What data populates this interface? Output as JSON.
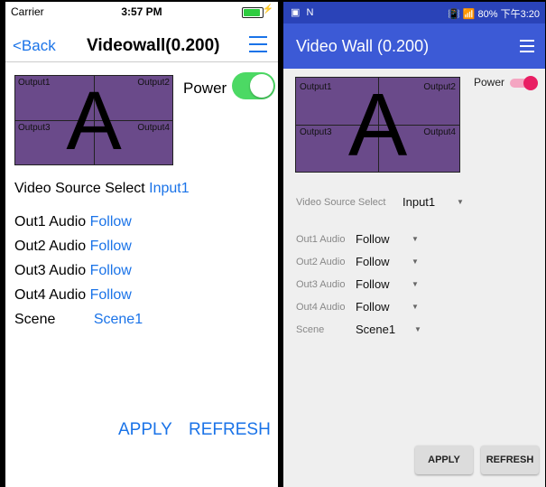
{
  "ios": {
    "status": {
      "carrier": "Carrier",
      "time": "3:57 PM",
      "battery_level": 0.95
    },
    "nav": {
      "back_label": "<Back",
      "title": "Videowall(0.200)"
    },
    "wall": {
      "letter": "A",
      "outputs": [
        "Output1",
        "Output2",
        "Output3",
        "Output4"
      ]
    },
    "power_label": "Power",
    "power_on": true,
    "video_source": {
      "label": "Video Source Select",
      "value": "Input1"
    },
    "audio": [
      {
        "label": "Out1 Audio",
        "value": "Follow"
      },
      {
        "label": "Out2 Audio",
        "value": "Follow"
      },
      {
        "label": "Out3 Audio",
        "value": "Follow"
      },
      {
        "label": "Out4 Audio",
        "value": "Follow"
      }
    ],
    "scene": {
      "label": "Scene",
      "value": "Scene1"
    },
    "apply_label": "APPLY",
    "refresh_label": "REFRESH"
  },
  "android": {
    "status": {
      "left": "▣ N",
      "right": "80% 下午3:20",
      "battery_percent": "80%"
    },
    "title": "Video Wall (0.200)",
    "wall": {
      "letter": "A",
      "outputs": [
        "Output1",
        "Output2",
        "Output3",
        "Output4"
      ]
    },
    "power_label": "Power",
    "power_on": true,
    "video_source": {
      "label": "Video Source Select",
      "value": "Input1"
    },
    "audio": [
      {
        "label": "Out1 Audio",
        "value": "Follow"
      },
      {
        "label": "Out2 Audio",
        "value": "Follow"
      },
      {
        "label": "Out3 Audio",
        "value": "Follow"
      },
      {
        "label": "Out4 Audio",
        "value": "Follow"
      }
    ],
    "scene": {
      "label": "Scene",
      "value": "Scene1"
    },
    "apply_label": "APPLY",
    "refresh_label": "REFRESH"
  },
  "colors": {
    "ios_accent": "#1a73e8",
    "ios_toggle": "#4cd964",
    "android_bar": "#3c5ad6",
    "android_status": "#2a43b8",
    "android_toggle": "#e91e63",
    "wall": "#6a4a8a"
  }
}
